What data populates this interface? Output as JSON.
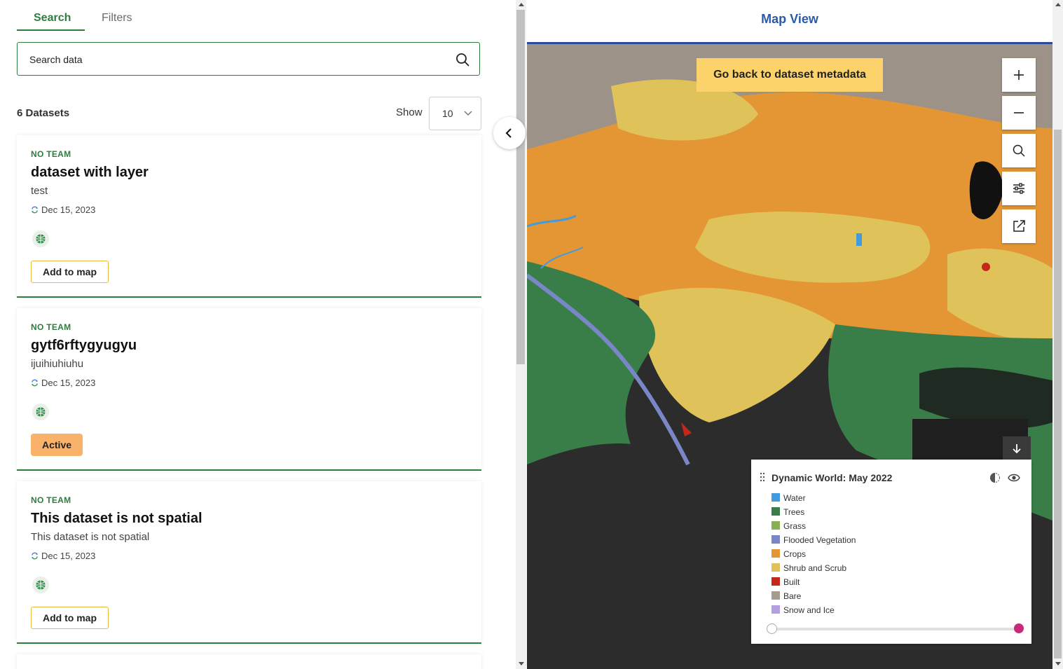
{
  "tabs": [
    {
      "label": "Search",
      "active": true
    },
    {
      "label": "Filters",
      "active": false
    }
  ],
  "search": {
    "placeholder": "Search data"
  },
  "results": {
    "count_label": "6 Datasets",
    "show_label": "Show",
    "show_value": "10"
  },
  "datasets": [
    {
      "team": "NO TEAM",
      "title": "dataset with layer",
      "description": "test",
      "date": "Dec 15, 2023",
      "action": "Add to map",
      "action_state": "add"
    },
    {
      "team": "NO TEAM",
      "title": "gytf6rftygyugyu",
      "description": "ijuihiuhiuhu",
      "date": "Dec 15, 2023",
      "action": "Active",
      "action_state": "active"
    },
    {
      "team": "NO TEAM",
      "title": "This dataset is not spatial",
      "description": "This dataset is not spatial",
      "date": "Dec 15, 2023",
      "action": "Add to map",
      "action_state": "add"
    }
  ],
  "map": {
    "header": "Map View",
    "back_button": "Go back to dataset metadata",
    "controls": [
      "zoom-in-icon",
      "zoom-out-icon",
      "search-icon",
      "settings-sliders-icon",
      "external-link-icon"
    ]
  },
  "legend": {
    "title": "Dynamic World: May 2022",
    "items": [
      {
        "label": "Water",
        "color": "#419bdf"
      },
      {
        "label": "Trees",
        "color": "#397d49"
      },
      {
        "label": "Grass",
        "color": "#88b053"
      },
      {
        "label": "Flooded Vegetation",
        "color": "#7a87c6"
      },
      {
        "label": "Crops",
        "color": "#e49635"
      },
      {
        "label": "Shrub and Scrub",
        "color": "#dfc35a"
      },
      {
        "label": "Built",
        "color": "#c4281b"
      },
      {
        "label": "Bare",
        "color": "#a59b8f"
      },
      {
        "label": "Snow and Ice",
        "color": "#b39fe1"
      }
    ],
    "opacity_range": [
      0,
      1
    ]
  },
  "colors": {
    "accent_green": "#2e7d3e",
    "map_header": "#2b5aa8",
    "back_button": "#fcd36b",
    "active_badge": "#f8b26a"
  }
}
